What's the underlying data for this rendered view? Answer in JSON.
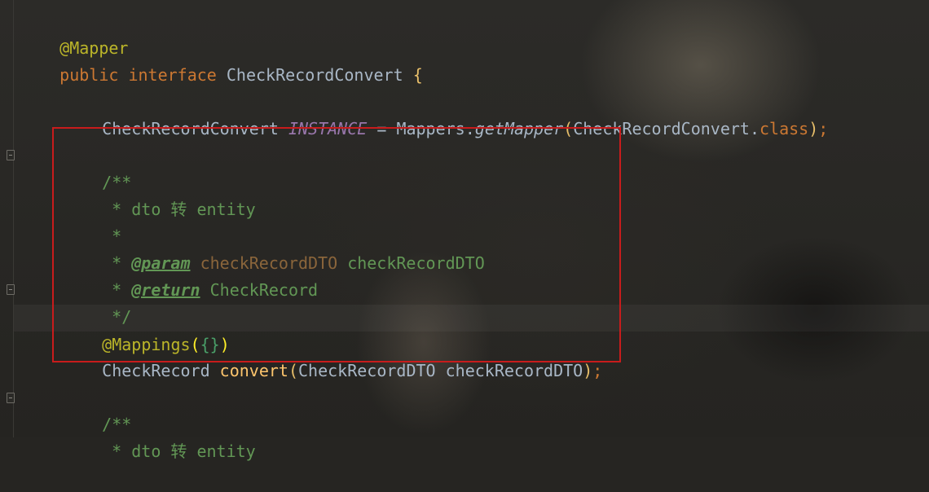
{
  "editor": {
    "l1": {
      "annotation": "@Mapper"
    },
    "l2": {
      "kw_public": "public",
      "kw_interface": "interface",
      "name": "CheckRecordConvert",
      "brace": "{"
    },
    "l4": {
      "type": "CheckRecordConvert",
      "field": "INSTANCE",
      "eq": "=",
      "cls": "Mappers",
      "dot1": ".",
      "method": "getMapper",
      "lp": "(",
      "arg": "CheckRecordConvert",
      "dot2": ".",
      "kw_class": "class",
      "rp": ")",
      "semi": ";"
    },
    "doc1": {
      "open": "/**",
      "line1": "* dto 转 entity",
      "line2": "*",
      "param_star": "*",
      "param_tag": "@param",
      "param_name": "checkRecordDTO",
      "param_desc": "checkRecordDTO",
      "return_star": "*",
      "return_tag": "@return",
      "return_desc": "CheckRecord",
      "close": "*/"
    },
    "mappings": {
      "name": "@Mappings",
      "lp": "(",
      "braces": "{}",
      "rp": ")"
    },
    "method": {
      "ret": "CheckRecord",
      "name": "convert",
      "lp": "(",
      "ptype": "CheckRecordDTO",
      "pname": "checkRecordDTO",
      "rp": ")",
      "semi": ";"
    },
    "doc2": {
      "open": "/**",
      "line1": "* dto 转 entity"
    }
  },
  "colors": {
    "background": "#262522",
    "default_text": "#a9b7c6",
    "keyword": "#cc7832",
    "annotation": "#bbb529",
    "static_field": "#9876aa",
    "method_decl": "#ffc66d",
    "doc_comment": "#629755",
    "highlight_box": "#c81c1c"
  }
}
